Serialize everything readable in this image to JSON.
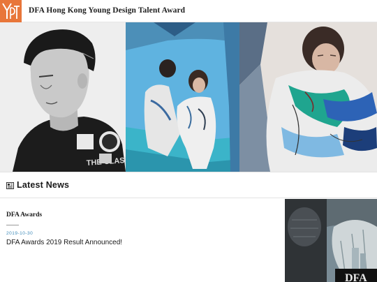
{
  "header": {
    "logo_alt": "YDT",
    "site_title": "DFA Hong Kong Young Design Talent Award"
  },
  "hero": {
    "panels": [
      {
        "name": "portrait-photo",
        "shirt_text": "THE CLASH"
      },
      {
        "name": "models-photo"
      },
      {
        "name": "fashion-photo"
      }
    ]
  },
  "news": {
    "icon": "newspaper-icon",
    "heading": "Latest News"
  },
  "article": {
    "category": "DFA Awards",
    "date": "2019-10-30",
    "title": "DFA Awards 2019 Result Announced!",
    "thumbnail_logo_text": "DFA"
  },
  "colors": {
    "brand_orange": "#e8763a",
    "date_blue": "#3b88b8"
  }
}
